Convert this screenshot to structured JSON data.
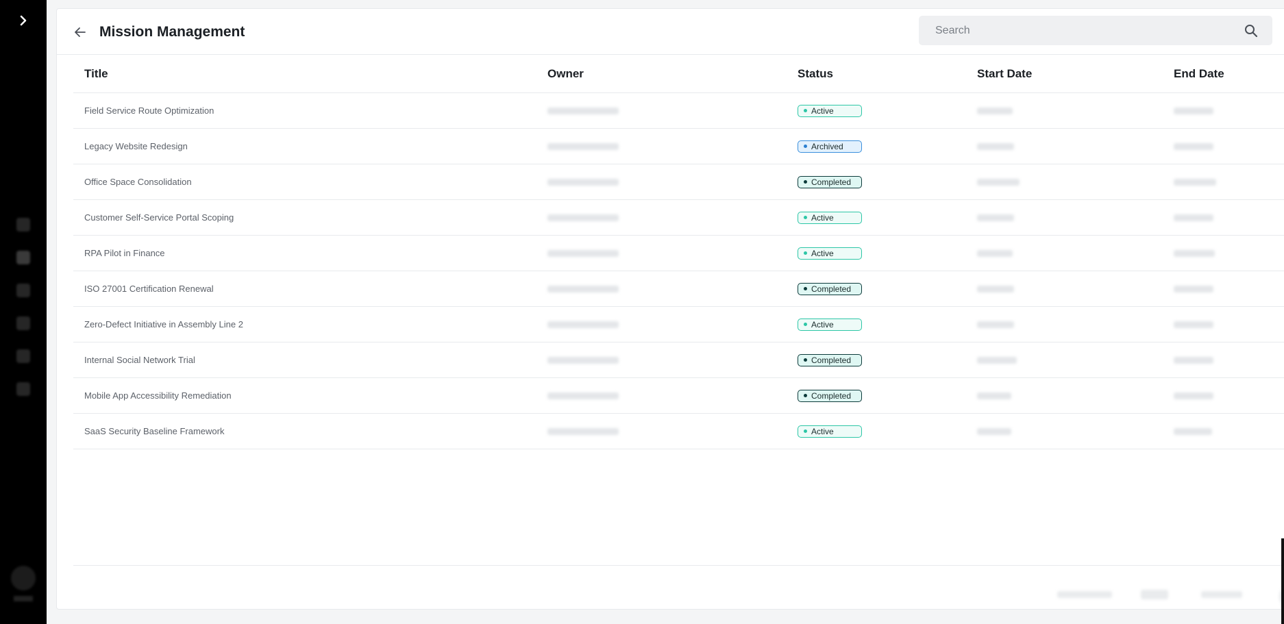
{
  "header": {
    "title": "Mission Management",
    "search_placeholder": "Search"
  },
  "table": {
    "columns": [
      "Title",
      "Owner",
      "Status",
      "Start Date",
      "End Date"
    ],
    "rows": [
      {
        "title": "Field Service Route Optimization",
        "status": "Active",
        "status_type": "active"
      },
      {
        "title": "Legacy Website Redesign",
        "status": "Archived",
        "status_type": "archived"
      },
      {
        "title": "Office Space Consolidation",
        "status": "Completed",
        "status_type": "completed"
      },
      {
        "title": "Customer Self-Service Portal Scoping",
        "status": "Active",
        "status_type": "active"
      },
      {
        "title": "RPA Pilot in Finance",
        "status": "Active",
        "status_type": "active"
      },
      {
        "title": "ISO 27001 Certification Renewal",
        "status": "Completed",
        "status_type": "completed"
      },
      {
        "title": "Zero-Defect Initiative in Assembly Line 2",
        "status": "Active",
        "status_type": "active"
      },
      {
        "title": "Internal Social Network Trial",
        "status": "Completed",
        "status_type": "completed"
      },
      {
        "title": "Mobile App Accessibility Remediation",
        "status": "Completed",
        "status_type": "completed"
      },
      {
        "title": "SaaS Security Baseline Framework",
        "status": "Active",
        "status_type": "active"
      }
    ]
  },
  "colors": {
    "active": "#2cc6a6",
    "archived": "#3a8fdc",
    "completed": "#0c3a3a",
    "sidebar": "#000000"
  },
  "icons": {
    "expand": "chevron-right-icon",
    "back": "arrow-left-icon",
    "search": "search-icon"
  }
}
